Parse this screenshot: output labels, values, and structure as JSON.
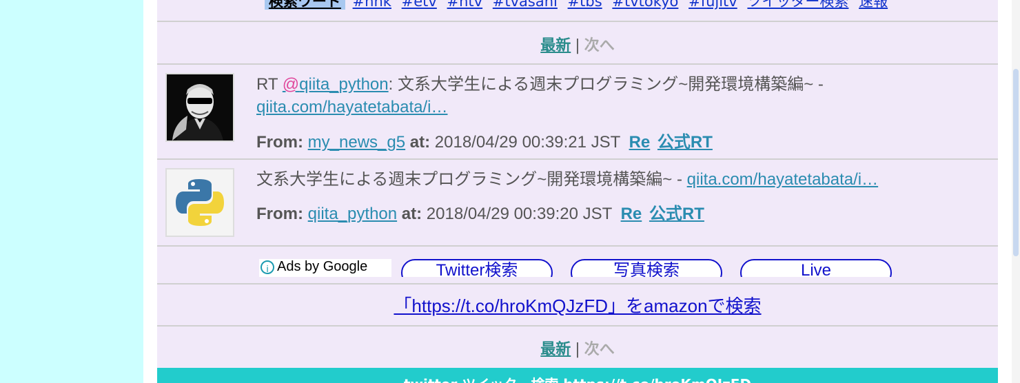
{
  "tags": {
    "keyword_label": "検索ワード",
    "items": [
      "#nhk",
      "#etv",
      "#ntv",
      "#tvasahi",
      "#tbs",
      "#tvtokyo",
      "#fujitv",
      "ツイッター検索",
      "速報"
    ]
  },
  "pager": {
    "latest": "最新",
    "sep": "|",
    "next": "次へ"
  },
  "tweets": [
    {
      "rt_prefix": "RT ",
      "at_mark": "@",
      "mention": "qiita_python",
      "text": ": 文系大学生による週末プログラミング~開発環境構築編~ - ",
      "link": "qiita.com/hayatetabata/i…",
      "from_label": "From:",
      "user": "my_news_g5",
      "at_label": "at:",
      "time": "2018/04/29 00:39:21 JST",
      "re": "Re",
      "official_rt": "公式RT",
      "avatar_icon": "man-sunglasses-avatar-icon"
    },
    {
      "text": "文系大学生による週末プログラミング~開発環境構築編~ - ",
      "link": "qiita.com/hayatetabata/i…",
      "from_label": "From:",
      "user": "qiita_python",
      "at_label": "at:",
      "time": "2018/04/29 00:39:20 JST",
      "re": "Re",
      "official_rt": "公式RT",
      "avatar_icon": "python-logo-avatar-icon"
    }
  ],
  "ads": {
    "info_glyph": "i",
    "label": "Ads by Google",
    "buttons": [
      "Twitter検索",
      "写真検索",
      "Live"
    ]
  },
  "amazon_search": "「https://t.co/hroKmQJzFD」をamazonで検索",
  "footer": "twitter ツイッター検索 https://t.co/hroKmQJzFD",
  "colors": {
    "background": "#ccffff",
    "content": "#f1e9f9",
    "footer": "#22cccc",
    "link": "#2a8cb0"
  }
}
